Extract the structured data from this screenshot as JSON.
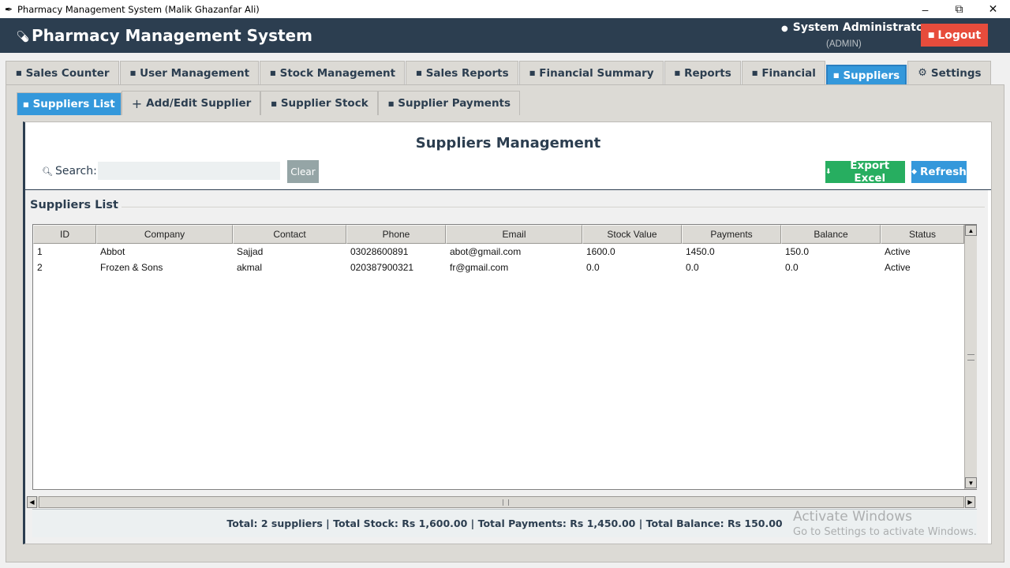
{
  "window": {
    "title": "Pharmacy Management System (Malik Ghazanfar Ali)",
    "controls": {
      "minimize": "–",
      "restore": "⧉",
      "close": "✕"
    }
  },
  "header": {
    "title": "Pharmacy Management System",
    "user_name": "System Administrator",
    "user_role": "(ADMIN)",
    "logout_label": "Logout"
  },
  "tabs": [
    {
      "label": "Sales Counter"
    },
    {
      "label": "User Management"
    },
    {
      "label": "Stock Management"
    },
    {
      "label": "Sales Reports"
    },
    {
      "label": "Financial Summary"
    },
    {
      "label": "Reports"
    },
    {
      "label": "Financial"
    },
    {
      "label": "Suppliers"
    },
    {
      "label": "Settings"
    }
  ],
  "active_tab": "Suppliers",
  "subtabs": [
    {
      "label": "Suppliers List"
    },
    {
      "label": "Add/Edit Supplier"
    },
    {
      "label": "Supplier Stock"
    },
    {
      "label": "Supplier Payments"
    }
  ],
  "page": {
    "heading": "Suppliers Management",
    "search_label": "Search:",
    "search_value": "",
    "clear_label": "Clear",
    "export_label": "Export Excel",
    "refresh_label": "Refresh",
    "group_title": "Suppliers List"
  },
  "table": {
    "columns": [
      "ID",
      "Company",
      "Contact",
      "Phone",
      "Email",
      "Stock Value",
      "Payments",
      "Balance",
      "Status"
    ],
    "rows": [
      [
        "1",
        "Abbot",
        "Sajjad",
        "03028600891",
        "abot@gmail.com",
        "1600.0",
        "1450.0",
        "150.0",
        "Active"
      ],
      [
        "2",
        "Frozen & Sons",
        "akmal",
        "020387900321",
        "fr@gmail.com",
        "0.0",
        "0.0",
        "0.0",
        "Active"
      ]
    ]
  },
  "summary": "Total: 2 suppliers | Total Stock: Rs 1,600.00 | Total Payments: Rs 1,450.00 | Total Balance: Rs 150.00",
  "watermark": {
    "line1": "Activate Windows",
    "line2": "Go to Settings to activate Windows."
  },
  "colors": {
    "header_bg": "#2c3e50",
    "accent": "#3498db",
    "logout": "#e74c3c",
    "export": "#27ae60",
    "clear": "#95a5a6"
  }
}
